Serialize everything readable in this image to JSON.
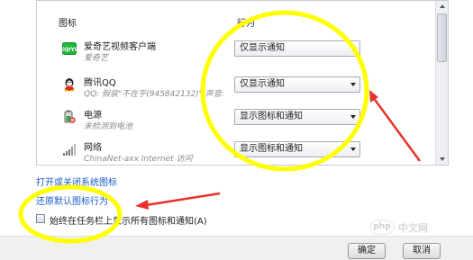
{
  "table": {
    "header_icons": "图标",
    "header_behavior": "行为",
    "rows": [
      {
        "name": "爱奇艺视频客户端",
        "sub": "爱奇艺",
        "behavior": "仅显示通知",
        "icon": "iqiyi-icon",
        "icon_label": "iQIYI"
      },
      {
        "name": "腾讯QQ",
        "sub": "QQ: 假装\"不在乎(945842132)\" 声音:",
        "behavior": "仅显示通知",
        "icon": "qq-icon"
      },
      {
        "name": "电源",
        "sub": "未检测到电池",
        "behavior": "显示图标和通知",
        "icon": "power-icon"
      },
      {
        "name": "网络",
        "sub": "ChinaNet-axx Internet 访问",
        "behavior": "显示图标和通知",
        "icon": "network-icon"
      }
    ]
  },
  "links": {
    "toggle_system_icons": "打开或关闭系统图标",
    "restore_defaults": "还原默认图标行为"
  },
  "checkbox": {
    "label": "始终在任务栏上显示所有图标和通知(A)",
    "checked": false
  },
  "buttons": {
    "ok": "确定",
    "cancel": "取消"
  },
  "watermark": {
    "logo": "php",
    "text": "中文网"
  },
  "colors": {
    "annotation_yellow": "#ffff00",
    "annotation_red": "#e8322e",
    "link_blue": "#1a5cc8"
  }
}
